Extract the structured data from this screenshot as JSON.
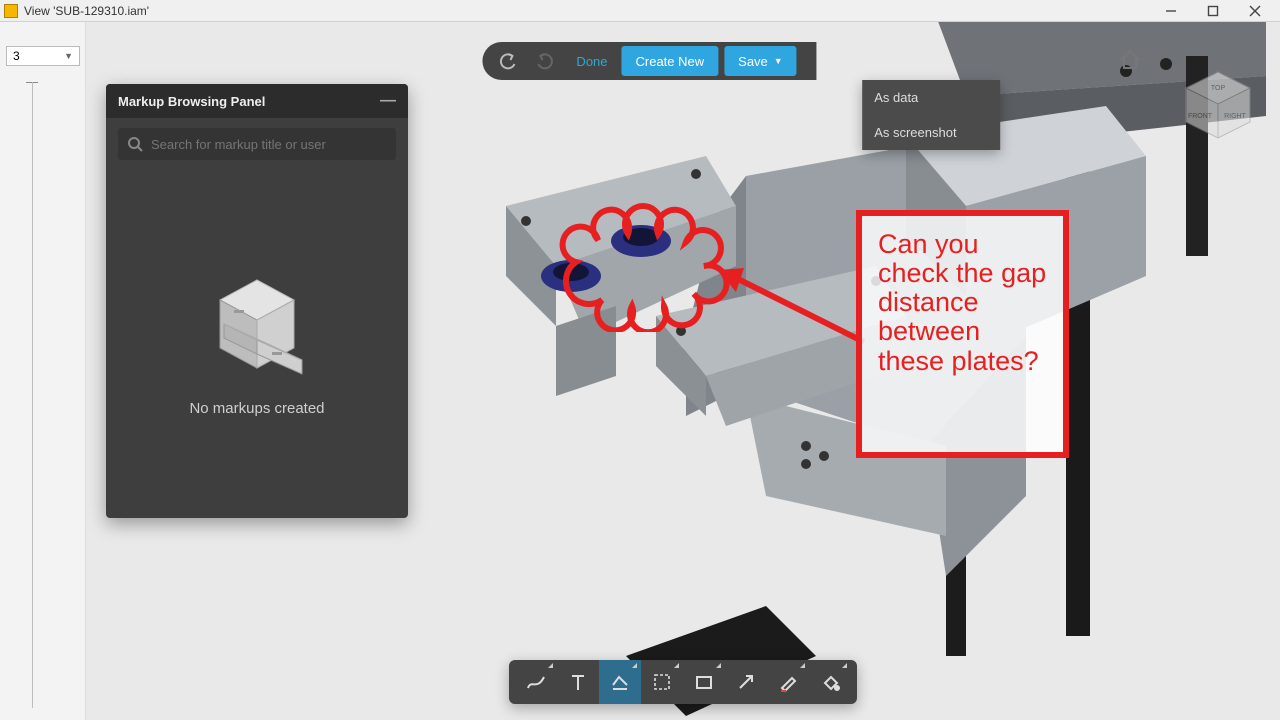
{
  "window": {
    "title": "View 'SUB-129310.iam'"
  },
  "page_selector": {
    "value": "3"
  },
  "top_toolbar": {
    "done": "Done",
    "create_new": "Create New",
    "save": "Save"
  },
  "save_menu": {
    "as_data": "As data",
    "as_screenshot": "As screenshot"
  },
  "markup_panel": {
    "title": "Markup Browsing Panel",
    "search_placeholder": "Search for markup title or user",
    "empty_message": "No markups created"
  },
  "annotation": {
    "text": "Can you check the gap distance between these plates?"
  },
  "viewcube": {
    "front": "FRONT",
    "right": "RIGHT",
    "top": "TOP"
  },
  "colors": {
    "accent": "#2fa6e0",
    "markup_red": "#e62020"
  }
}
